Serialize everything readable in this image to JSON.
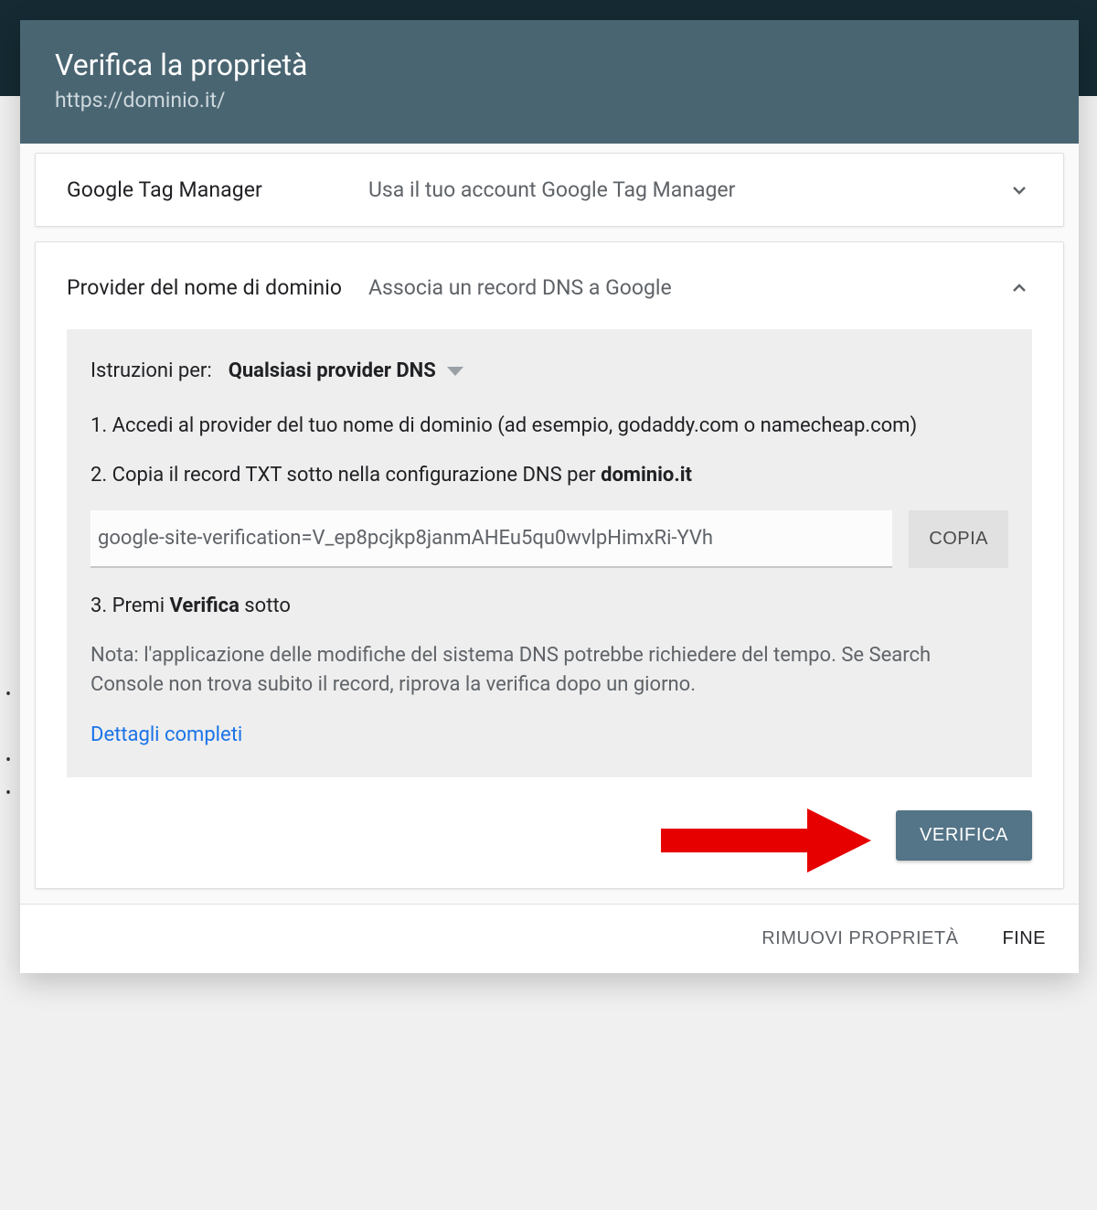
{
  "dialog": {
    "title": "Verifica la proprietà",
    "subtitle": "https://dominio.it/"
  },
  "methods": {
    "gtm": {
      "name": "Google Tag Manager",
      "desc": "Usa il tuo account Google Tag Manager"
    },
    "dns": {
      "name": "Provider del nome di dominio",
      "desc": "Associa un record DNS a Google"
    }
  },
  "instructions": {
    "label": "Istruzioni per:",
    "dropdown_value": "Qualsiasi provider DNS",
    "step1": "1. Accedi al provider del tuo nome di dominio (ad esempio, godaddy.com o namecheap.com)",
    "step2_prefix": "2. Copia il record TXT sotto nella configurazione DNS per ",
    "step2_domain": "dominio.it",
    "txt_record": "google-site-verification=V_ep8pcjkp8janmAHEu5qu0wvlpHimxRi-YVh",
    "copy_label": "COPIA",
    "step3_prefix": "3. Premi ",
    "step3_bold": "Verifica",
    "step3_suffix": " sotto",
    "note": "Nota: l'applicazione delle modifiche del sistema DNS potrebbe richiedere del tempo. Se Search Console non trova subito il record, riprova la verifica dopo un giorno.",
    "details_link": "Dettagli completi"
  },
  "buttons": {
    "verify": "VERIFICA",
    "remove": "RIMUOVI PROPRIETÀ",
    "done": "FINE"
  }
}
